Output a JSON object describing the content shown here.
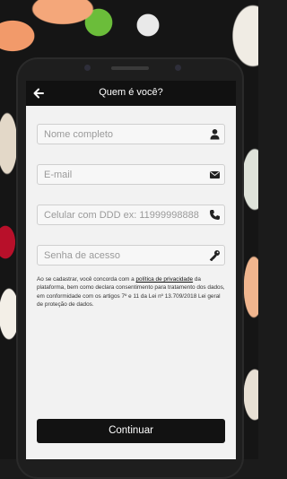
{
  "header": {
    "title": "Quem é você?"
  },
  "form": {
    "name_placeholder": "Nome completo",
    "email_placeholder": "E-mail",
    "phone_placeholder": "Celular com DDD ex: 11999998888",
    "password_placeholder": "Senha de acesso"
  },
  "legal": {
    "before_link": "Ao se cadastrar, você concorda com a ",
    "link_text": "política de privacidade",
    "after_link": " da plataforma, bem como declara consentimento para tratamento dos dados, em conformidade com os artigos 7º e 11 da Lei nº 13.709/2018 Lei geral de proteção de dados."
  },
  "actions": {
    "continue_label": "Continuar"
  },
  "icons": {
    "back": "arrow-left-icon",
    "name": "user-icon",
    "email": "envelope-icon",
    "phone": "phone-icon",
    "password": "key-icon"
  }
}
